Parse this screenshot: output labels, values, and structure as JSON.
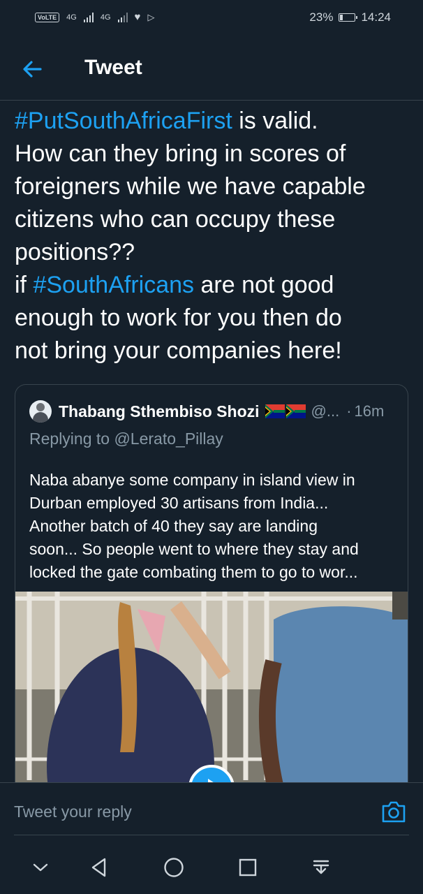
{
  "status_bar": {
    "volte": "VoLTE",
    "network_1": "4G",
    "network_2": "4G",
    "battery_percent": "23%",
    "battery_level": 0.23,
    "time": "14:24",
    "icons": [
      "volte-icon",
      "signal-icon",
      "signal-icon",
      "heart-icon",
      "play-store-icon",
      "battery-icon"
    ]
  },
  "header": {
    "title": "Tweet",
    "back_icon": "arrow-left-icon"
  },
  "tweet": {
    "lines": [
      {
        "hashtag": "#PutSouthAfricaFirst",
        "text": " is valid."
      },
      {
        "text": "How can they bring in scores of"
      },
      {
        "text": "foreigners while we have capable"
      },
      {
        "text": "citizens who can occupy these"
      },
      {
        "text": "positions??"
      },
      {
        "prefix": "if ",
        "hashtag": "#SouthAfricans",
        "text": " are not good"
      },
      {
        "text": "enough to work for you then do"
      },
      {
        "text": "not bring your companies here!"
      }
    ]
  },
  "quoted_tweet": {
    "name": "Thabang Sthembiso Shozi",
    "flags": [
      "south-africa-flag-icon",
      "south-africa-flag-icon"
    ],
    "handle": "@...",
    "separator": "·",
    "time": "16m",
    "replying_to": "Replying to @Lerato_Pillay",
    "body_lines": [
      "Naba abanye some company in island view in",
      "Durban employed 30 artisans from India...",
      "Another batch of 40 they say are landing",
      "soon... So people went to where they stay and",
      "locked the gate combating them to go to wor..."
    ],
    "media": {
      "type": "video",
      "play_icon": "play-icon"
    }
  },
  "reply_bar": {
    "placeholder": "Tweet your reply",
    "camera_icon": "camera-icon"
  },
  "nav_bar": {
    "icons": [
      "chevron-down-icon",
      "back-triangle-icon",
      "home-circle-icon",
      "recents-square-icon",
      "notification-pull-icon"
    ]
  },
  "colors": {
    "background": "#15202b",
    "accent": "#1da1f2",
    "secondary_text": "#8899a6",
    "divider": "#38444d"
  }
}
